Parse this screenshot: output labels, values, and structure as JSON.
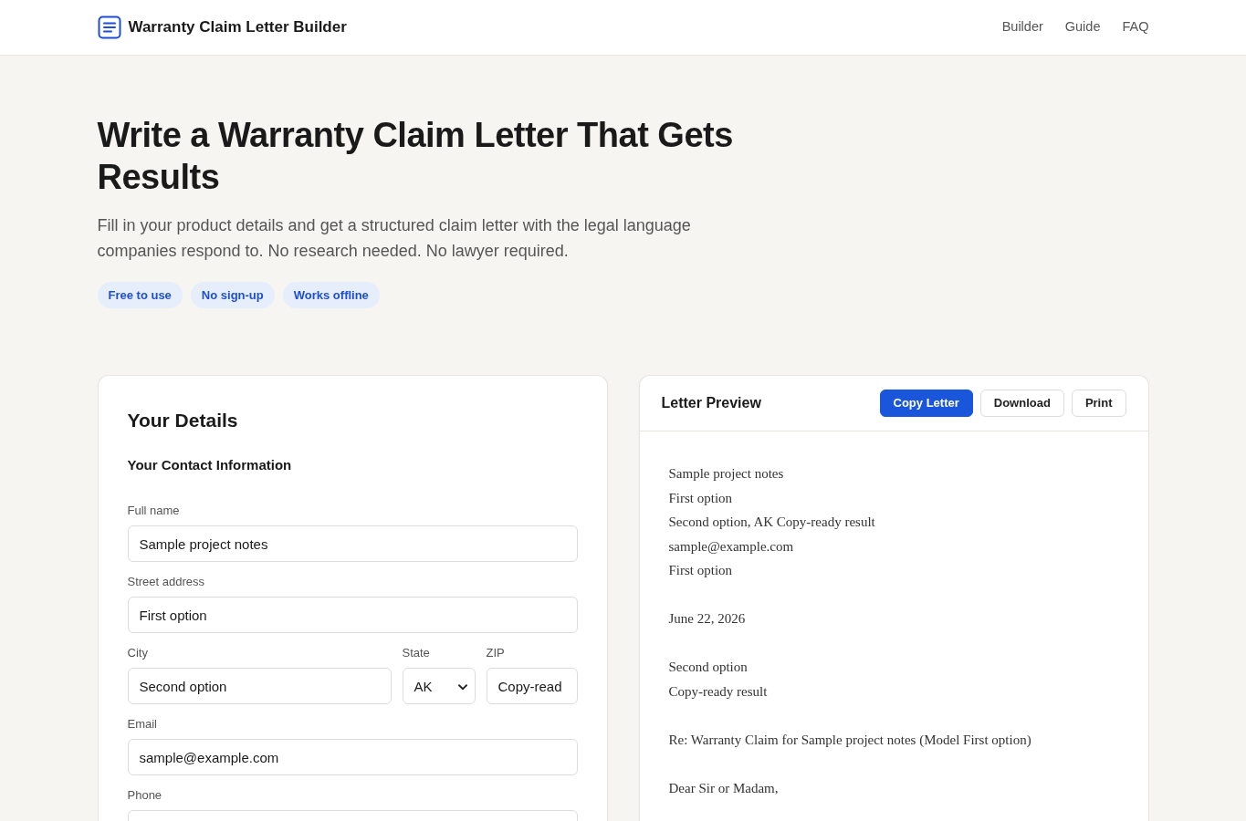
{
  "header": {
    "title": "Warranty Claim Letter Builder",
    "nav": [
      {
        "label": "Builder"
      },
      {
        "label": "Guide"
      },
      {
        "label": "FAQ"
      }
    ]
  },
  "hero": {
    "title": "Write a Warranty Claim Letter That Gets Results",
    "subtitle": "Fill in your product details and get a structured claim letter with the legal language companies respond to. No research needed. No lawyer required.",
    "badges": [
      "Free to use",
      "No sign-up",
      "Works offline"
    ]
  },
  "form_card": {
    "title": "Your Details",
    "section_title": "Your Contact Information",
    "rows": [
      [
        {
          "kind": "text",
          "label": "Full name",
          "value": "Sample project notes"
        }
      ],
      [
        {
          "kind": "text",
          "label": "Street address",
          "value": "First option"
        }
      ],
      [
        {
          "kind": "text",
          "label": "City",
          "value": "Second option"
        },
        {
          "kind": "select",
          "label": "State",
          "value": "AK"
        },
        {
          "kind": "text",
          "label": "ZIP",
          "value": "Copy-read"
        }
      ],
      [
        {
          "kind": "text",
          "label": "Email",
          "value": "sample@example.com"
        }
      ],
      [
        {
          "kind": "text",
          "label": "Phone"
        }
      ]
    ]
  },
  "preview_card": {
    "title": "Letter Preview",
    "buttons": [
      {
        "label": "Copy Letter",
        "kind": "primary"
      },
      {
        "label": "Download",
        "kind": "outline"
      },
      {
        "label": "Print",
        "kind": "outline"
      }
    ],
    "paragraphs": [
      [
        "Sample project notes",
        "First option",
        "Second option, AK Copy-ready result",
        "sample@example.com",
        "First option"
      ],
      [
        "June 22, 2026"
      ],
      [
        "Second option",
        "Copy-ready result"
      ],
      [
        "Re: Warranty Claim for Sample project notes (Model First option)"
      ],
      [
        "Dear Sir or Madam,"
      ]
    ]
  }
}
